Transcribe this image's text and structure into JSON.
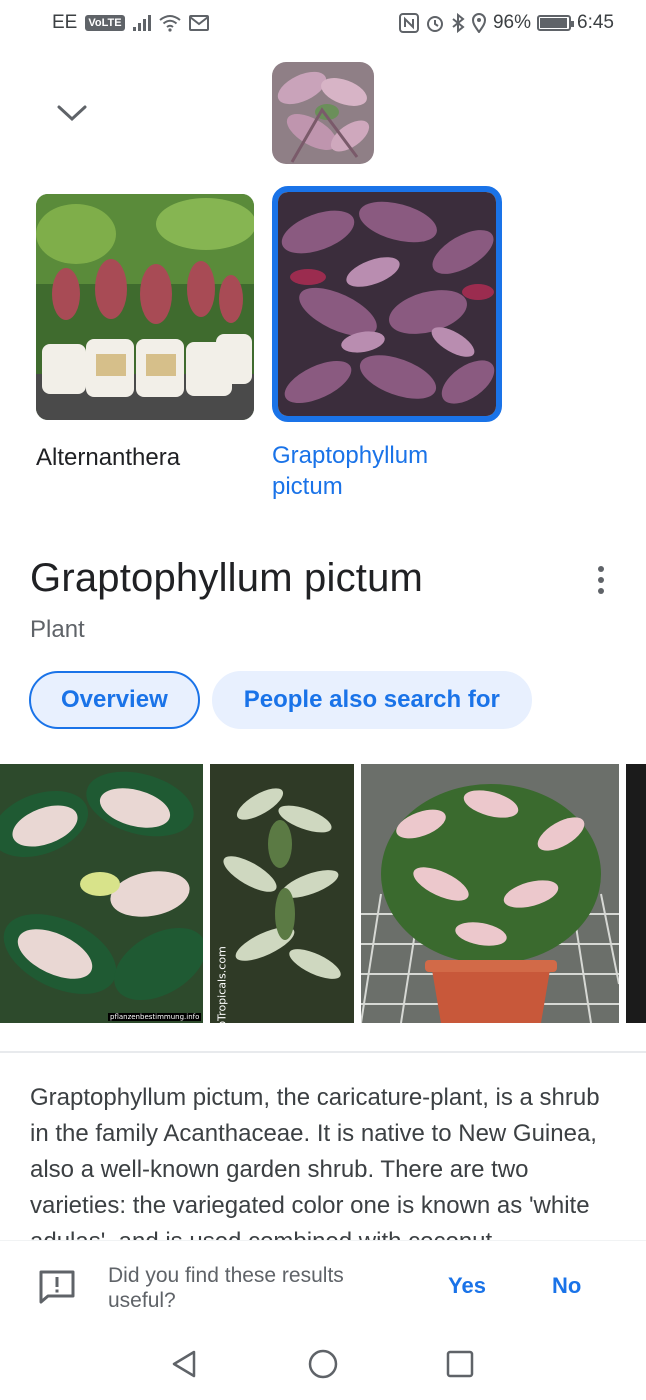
{
  "status_bar": {
    "carrier": "EE",
    "volte": "VoLTE",
    "battery": "96%",
    "battery_level": 0.96,
    "time": "6:45",
    "icons": [
      "signal-icon",
      "wifi-icon",
      "gmail-icon",
      "nfc-icon",
      "alarm-icon",
      "bluetooth-icon",
      "location-icon",
      "battery-icon"
    ]
  },
  "results": [
    {
      "label": "Alternanthera",
      "selected": false
    },
    {
      "label": "Graptophyllum pictum",
      "selected": true
    }
  ],
  "knowledge_panel": {
    "title": "Graptophyllum pictum",
    "subtitle": "Plant",
    "tabs": [
      "Overview",
      "People also search for"
    ],
    "description": "Graptophyllum pictum, the caricature-plant, is a shrub in the family Acanthaceae. It is native to New Guinea, also a well-known garden shrub. There are two varieties: the variegated color one is known as 'white adulas', and is used combined with coconut"
  },
  "gallery": {
    "watermark_1": "pflanzenbestimmung.info",
    "watermark_2": "©TopTropicals.com"
  },
  "feedback": {
    "question": "Did you find these results useful?",
    "yes": "Yes",
    "no": "No"
  },
  "colors": {
    "accent": "#1a73e8",
    "chip_bg": "#e8f0fe"
  }
}
